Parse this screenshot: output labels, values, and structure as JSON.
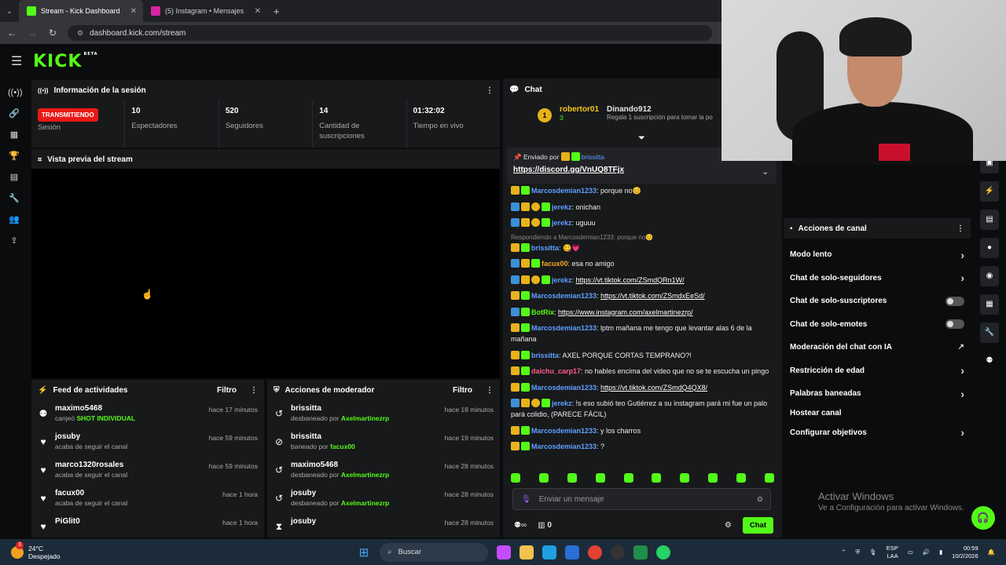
{
  "browser": {
    "tabs": [
      {
        "title": "Stream - Kick Dashboard",
        "color": "#53fc18",
        "active": true
      },
      {
        "title": "(5) Instagram • Mensajes",
        "color": "#d6249f",
        "active": false
      }
    ],
    "url": "dashboard.kick.com/stream"
  },
  "header": {
    "logo": "KICK",
    "beta": "BETA"
  },
  "session": {
    "title": "Información de la sesión",
    "live_badge": "TRANSMITIENDO",
    "session_label": "Sesión",
    "stats": [
      {
        "value": "10",
        "label": "Espectadores"
      },
      {
        "value": "520",
        "label": "Seguidores"
      },
      {
        "value": "14",
        "label": "Cantidad de suscripciones"
      },
      {
        "value": "01:32:02",
        "label": "Tiempo en vivo"
      }
    ]
  },
  "preview": {
    "title": "Vista previa del stream"
  },
  "feed": {
    "title": "Feed de actividades",
    "filter": "Filtro",
    "items": [
      {
        "icon": "redeem-icon",
        "name": "maximo5468",
        "sub": "canjeó",
        "highlight": "SHOT INDIVIDUAL",
        "time": "hace 17 minutos"
      },
      {
        "icon": "heart-icon",
        "name": "josuby",
        "sub": "acaba de seguir el canal",
        "highlight": "",
        "time": "hace 59 minutos"
      },
      {
        "icon": "heart-icon",
        "name": "marco1320rosales",
        "sub": "acaba de seguir el canal",
        "highlight": "",
        "time": "hace 59 minutos"
      },
      {
        "icon": "heart-icon",
        "name": "facux00",
        "sub": "acaba de seguir el canal",
        "highlight": "",
        "time": "hace 1 hora"
      },
      {
        "icon": "heart-icon",
        "name": "PiGlit0",
        "sub": "",
        "highlight": "",
        "time": "hace 1 hora"
      }
    ]
  },
  "modactions": {
    "title": "Acciones de moderador",
    "filter": "Filtro",
    "items": [
      {
        "icon": "undo-icon",
        "name": "brissitta",
        "sub": "desbaneado por",
        "by": "Axelmartinezrp",
        "time": "hace 18 minutos"
      },
      {
        "icon": "ban-icon",
        "name": "brissitta",
        "sub": "baneado por",
        "by": "facux00",
        "time": "hace 19 minutos"
      },
      {
        "icon": "undo-icon",
        "name": "maximo5468",
        "sub": "desbaneado por",
        "by": "Axelmartinezrp",
        "time": "hace 28 minutos"
      },
      {
        "icon": "undo-icon",
        "name": "josuby",
        "sub": "desbaneado por",
        "by": "Axelmartinezrp",
        "time": "hace 28 minutos"
      },
      {
        "icon": "hourglass-icon",
        "name": "josuby",
        "sub": "",
        "by": "",
        "time": "hace 28 minutos"
      }
    ]
  },
  "chat": {
    "title": "Chat",
    "gift": {
      "rank": "1",
      "user": "robertor01",
      "count": "3",
      "user2": "Dinando912",
      "text": "Regala 1 suscripción para tomar la po"
    },
    "pinned": {
      "label": "Enviado por",
      "user": "brissitta",
      "link": "https://discord.gg/VnUQ8TFjx"
    },
    "messages": [
      {
        "badges": [
          "crown",
          "sub"
        ],
        "user": "Marcosdemian1233",
        "color": "#5ea0ff",
        "text": ": porque no😊",
        "link": ""
      },
      {
        "badges": [
          "gem",
          "crown",
          "one",
          "sub"
        ],
        "user": "jerekz",
        "color": "#5ea0ff",
        "text": ": onichan",
        "link": ""
      },
      {
        "badges": [
          "gem",
          "crown",
          "one",
          "sub"
        ],
        "user": "jerekz",
        "color": "#5ea0ff",
        "text": ": uguuu",
        "link": ""
      },
      {
        "reply": "Respondiendo a Marcosdemian1233: porque no😊",
        "badges": [
          "crown",
          "sub"
        ],
        "user": "brissitta",
        "color": "#5ea0ff",
        "text": ": 😋💗",
        "link": ""
      },
      {
        "badges": [
          "gem",
          "crown",
          "sub"
        ],
        "user": "facux00",
        "color": "#f5a623",
        "text": ": esa no amigo",
        "link": ""
      },
      {
        "badges": [
          "gem",
          "crown",
          "one",
          "sub"
        ],
        "user": "jerekz",
        "color": "#5ea0ff",
        "text": ": ",
        "link": "https://vt.tiktok.com/ZSmdQRn1W/"
      },
      {
        "badges": [
          "crown",
          "sub"
        ],
        "user": "Marcosdemian1233",
        "color": "#5ea0ff",
        "text": ": ",
        "link": "https://vt.tiktok.com/ZSmdxEeSd/"
      },
      {
        "badges": [
          "gem",
          "sub"
        ],
        "user": "BotRix",
        "color": "#53fc18",
        "text": ": ",
        "link": "https://www.instagram.com/axelmartinezrp/"
      },
      {
        "badges": [
          "crown",
          "sub"
        ],
        "user": "Marcosdemian1233",
        "color": "#5ea0ff",
        "text": ": lptm mañana me tengo que levantar alas 6 de la mañana",
        "link": ""
      },
      {
        "badges": [
          "crown",
          "sub"
        ],
        "user": "brissitta",
        "color": "#5ea0ff",
        "text": ": AXEL PORQUE CORTAS TEMPRANO?!",
        "link": ""
      },
      {
        "badges": [
          "crown",
          "sub"
        ],
        "user": "daichu_carp17",
        "color": "#ff5c8a",
        "text": ": no hables encima del video que no se te escucha un pingo",
        "link": ""
      },
      {
        "badges": [
          "crown",
          "sub"
        ],
        "user": "Marcosdemian1233",
        "color": "#5ea0ff",
        "text": ": ",
        "link": "https://vt.tiktok.com/ZSmdQ4QX8/"
      },
      {
        "badges": [
          "gem",
          "crown",
          "one",
          "sub"
        ],
        "user": "jerekz",
        "color": "#5ea0ff",
        "text": ": !s eso subió teo Gutiérrez a su instagram pará mi fue un palo pará colidio, (PARECE FÁCIL)",
        "link": ""
      },
      {
        "badges": [
          "crown",
          "sub"
        ],
        "user": "Marcosdemian1233",
        "color": "#5ea0ff",
        "text": ": y los charros",
        "link": ""
      },
      {
        "badges": [
          "crown",
          "sub"
        ],
        "user": "Marcosdemian1233",
        "color": "#5ea0ff",
        "text": ": ?",
        "link": ""
      }
    ],
    "input_placeholder": "Enviar un mensaje",
    "footer_count": "0",
    "send_label": "Chat"
  },
  "channel_actions": {
    "title": "Acciones de canal",
    "items": [
      {
        "label": "Modo lento",
        "control": "chevron"
      },
      {
        "label": "Chat de solo-seguidores",
        "control": "chevron"
      },
      {
        "label": "Chat de solo-suscriptores",
        "control": "toggle"
      },
      {
        "label": "Chat de solo-emotes",
        "control": "toggle"
      },
      {
        "label": "Moderación del chat con IA",
        "control": "external"
      },
      {
        "label": "Restricción de edad",
        "control": "chevron"
      },
      {
        "label": "Palabras baneadas",
        "control": "chevron"
      },
      {
        "label": "Hostear canal",
        "control": "none"
      },
      {
        "label": "Configurar objetivos",
        "control": "chevron"
      }
    ]
  },
  "watermark": {
    "line1": "Activar Windows",
    "line2": "Ve a Configuración para activar Windows."
  },
  "taskbar": {
    "temp": "24°C",
    "weather": "Despejado",
    "weather_badge": "3",
    "search": "Buscar",
    "lang": "ESP",
    "lang2": "LAA",
    "time": "00:59",
    "date": "10/2/2026"
  },
  "colors": {
    "accent": "#53fc18",
    "live": "#e91916"
  }
}
